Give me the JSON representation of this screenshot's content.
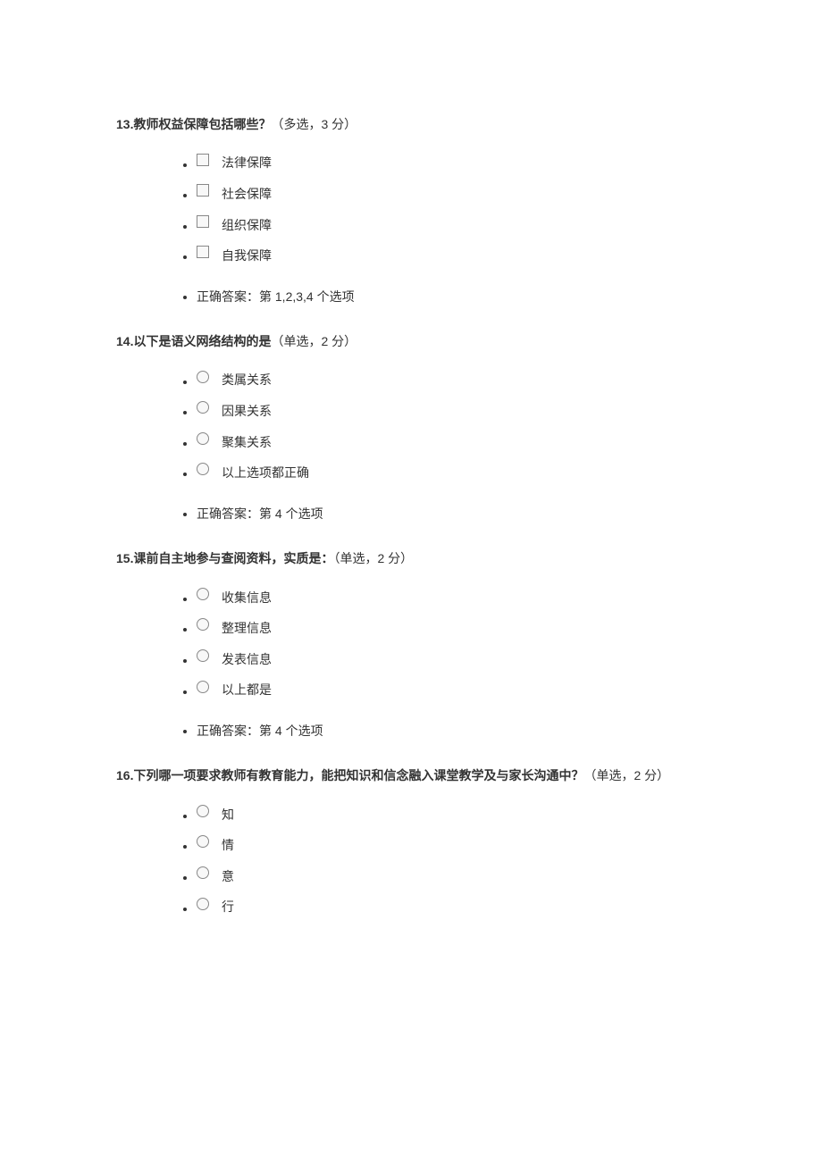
{
  "questions": [
    {
      "number": "13.",
      "title": "教师权益保障包括哪些？",
      "meta": "（多选，3 分）",
      "type": "checkbox",
      "options": [
        "法律保障",
        "社会保障",
        "组织保障",
        "自我保障"
      ],
      "answer": "正确答案：第 1,2,3,4 个选项"
    },
    {
      "number": "14.",
      "title": "以下是语义网络结构的是",
      "meta": "（单选，2 分）",
      "type": "radio",
      "options": [
        "类属关系",
        "因果关系",
        "聚集关系",
        "以上选项都正确"
      ],
      "answer": "正确答案：第 4 个选项"
    },
    {
      "number": "15.",
      "title": "课前自主地参与查阅资料，实质是：",
      "meta": "（单选，2 分）",
      "type": "radio",
      "options": [
        "收集信息",
        "整理信息",
        "发表信息",
        "以上都是"
      ],
      "answer": "正确答案：第 4 个选项"
    },
    {
      "number": "16.",
      "title": "下列哪一项要求教师有教育能力，能把知识和信念融入课堂教学及与家长沟通中？",
      "meta": "（单选，2 分）",
      "type": "radio",
      "options": [
        "知",
        "情",
        "意",
        "行"
      ],
      "answer": null
    }
  ]
}
